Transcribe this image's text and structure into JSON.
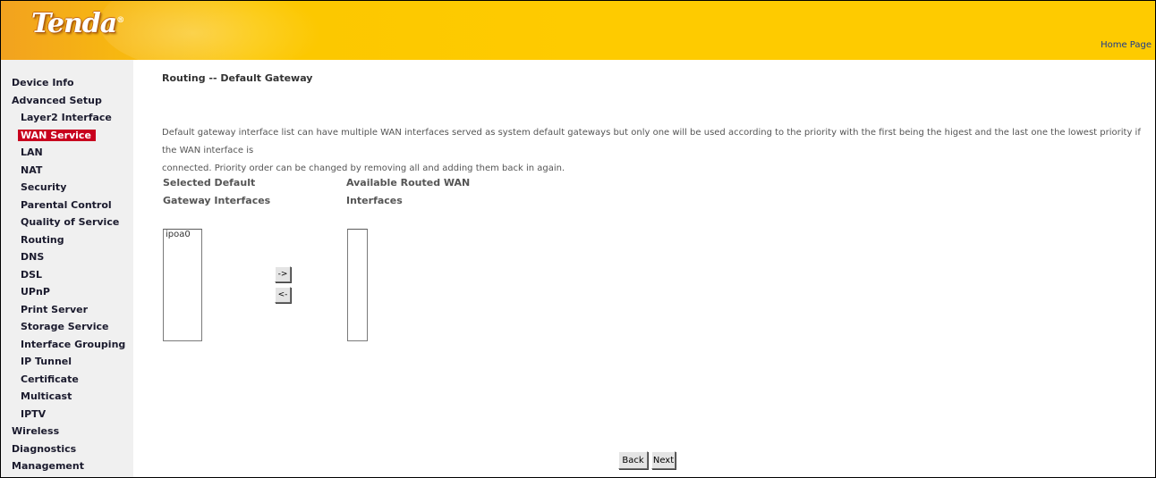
{
  "header": {
    "logo_text": "Tenda",
    "logo_mark": "®",
    "home_link": "Home Page",
    "colors": {
      "bar": "#fecb00",
      "active_nav": "#c8001e"
    }
  },
  "sidebar": {
    "items": [
      {
        "label": "Device Info",
        "level": "top"
      },
      {
        "label": "Advanced Setup",
        "level": "top"
      },
      {
        "label": "Layer2 Interface",
        "level": "sub"
      },
      {
        "label": "WAN Service",
        "level": "sub",
        "active": true
      },
      {
        "label": "LAN",
        "level": "sub"
      },
      {
        "label": "NAT",
        "level": "sub"
      },
      {
        "label": "Security",
        "level": "sub"
      },
      {
        "label": "Parental Control",
        "level": "sub"
      },
      {
        "label": "Quality of Service",
        "level": "sub"
      },
      {
        "label": "Routing",
        "level": "sub"
      },
      {
        "label": "DNS",
        "level": "sub"
      },
      {
        "label": "DSL",
        "level": "sub"
      },
      {
        "label": "UPnP",
        "level": "sub"
      },
      {
        "label": "Print Server",
        "level": "sub"
      },
      {
        "label": "Storage Service",
        "level": "sub"
      },
      {
        "label": "Interface Grouping",
        "level": "sub"
      },
      {
        "label": "IP Tunnel",
        "level": "sub"
      },
      {
        "label": "Certificate",
        "level": "sub"
      },
      {
        "label": "Multicast",
        "level": "sub"
      },
      {
        "label": "IPTV",
        "level": "sub"
      },
      {
        "label": "Wireless",
        "level": "top"
      },
      {
        "label": "Diagnostics",
        "level": "top"
      },
      {
        "label": "Management",
        "level": "top"
      }
    ]
  },
  "main": {
    "title": "Routing -- Default Gateway",
    "description_line1": "Default gateway interface list can have multiple WAN interfaces served as system default gateways but only one will be used according to the priority with the first being the higest and the last one the lowest priority if the WAN interface is",
    "description_line2": "connected. Priority order can be changed by removing all and adding them back in again.",
    "selected": {
      "label_line1": "Selected Default",
      "label_line2": "Gateway Interfaces",
      "options": [
        "ipoa0"
      ]
    },
    "available": {
      "label_line1": "Available Routed WAN",
      "label_line2": "Interfaces",
      "options": []
    },
    "move_right_label": "->",
    "move_left_label": "<-",
    "back_label": "Back",
    "next_label": "Next"
  }
}
